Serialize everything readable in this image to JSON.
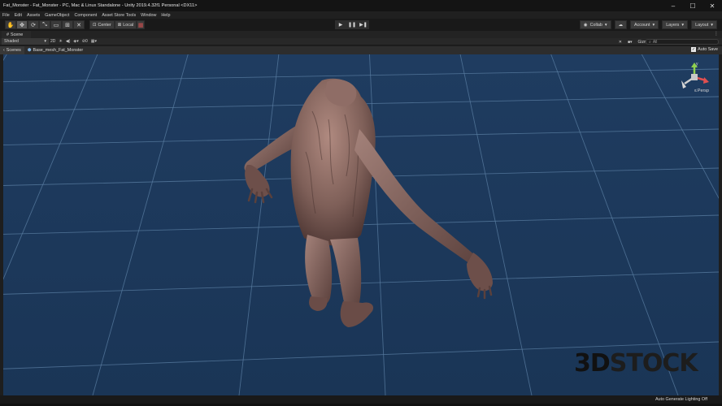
{
  "window": {
    "title": "Fat_Monster - Fat_Monster - PC, Mac & Linux Standalone - Unity 2019.4.32f1 Personal <DX11>",
    "controls": [
      "–",
      "☐",
      "✕"
    ]
  },
  "menu": [
    "File",
    "Edit",
    "Assets",
    "GameObject",
    "Component",
    "Asset Store Tools",
    "Window",
    "Help"
  ],
  "toolbar": {
    "pivot_center": "Center",
    "pivot_local": "Local",
    "collab": "Collab",
    "account": "Account",
    "layers": "Layers",
    "layout": "Layout"
  },
  "scene_tab": {
    "label": "Scene"
  },
  "scene_toolbar": {
    "shading_mode": "Shaded",
    "mode_2d": "2D",
    "fx_count": "0",
    "gizmos": "Gizmos",
    "search_placeholder": "All"
  },
  "breadcrumbs": [
    "Scenes",
    "Base_mesh_Fat_Monster"
  ],
  "auto_save": {
    "label": "Auto Save",
    "checked": true
  },
  "gizmo": {
    "projection": "Persp",
    "axis_y": "y"
  },
  "watermark": {
    "text_a": "3D",
    "text_b": "STOCK"
  },
  "status": {
    "text": "Auto Generate Lighting Off"
  },
  "colors": {
    "sky": "#1d3a5c",
    "grid": "#5d7ea0",
    "skin": "#8a6a62",
    "ui_bg": "#282828"
  }
}
